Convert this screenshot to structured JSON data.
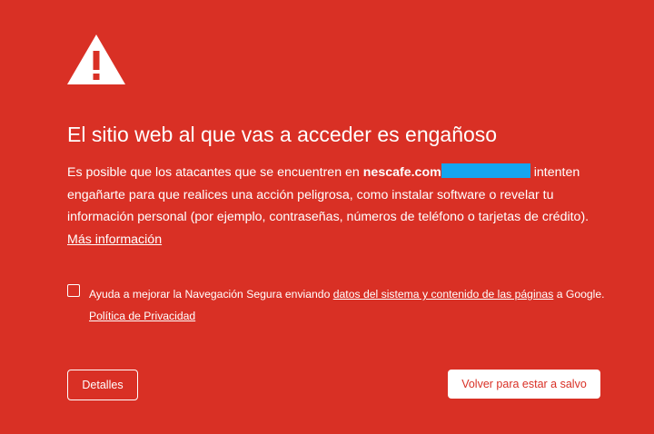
{
  "icon": "warning-triangle-icon",
  "colors": {
    "background": "#d93025",
    "text": "#ffffff",
    "redaction": "#15a5ef"
  },
  "title": "El sitio web al que vas a acceder es engañoso",
  "body": {
    "part1": "Es posible que los atacantes que se encuentren en ",
    "domain": "nescafe.com",
    "part2": "intenten engañarte para que realices una acción peligrosa, como instalar software o revelar tu información personal (por ejemplo, contraseñas, números de teléfono o tarjetas de crédito). ",
    "learn_more": "Más información"
  },
  "optin": {
    "checked": false,
    "text1": "Ayuda a mejorar la Navegación Segura enviando ",
    "link1": "datos del sistema y contenido de las páginas",
    "text2": " a Google. ",
    "link2": "Política de Privacidad"
  },
  "buttons": {
    "details": "Detalles",
    "back_to_safety": "Volver para estar a salvo"
  }
}
